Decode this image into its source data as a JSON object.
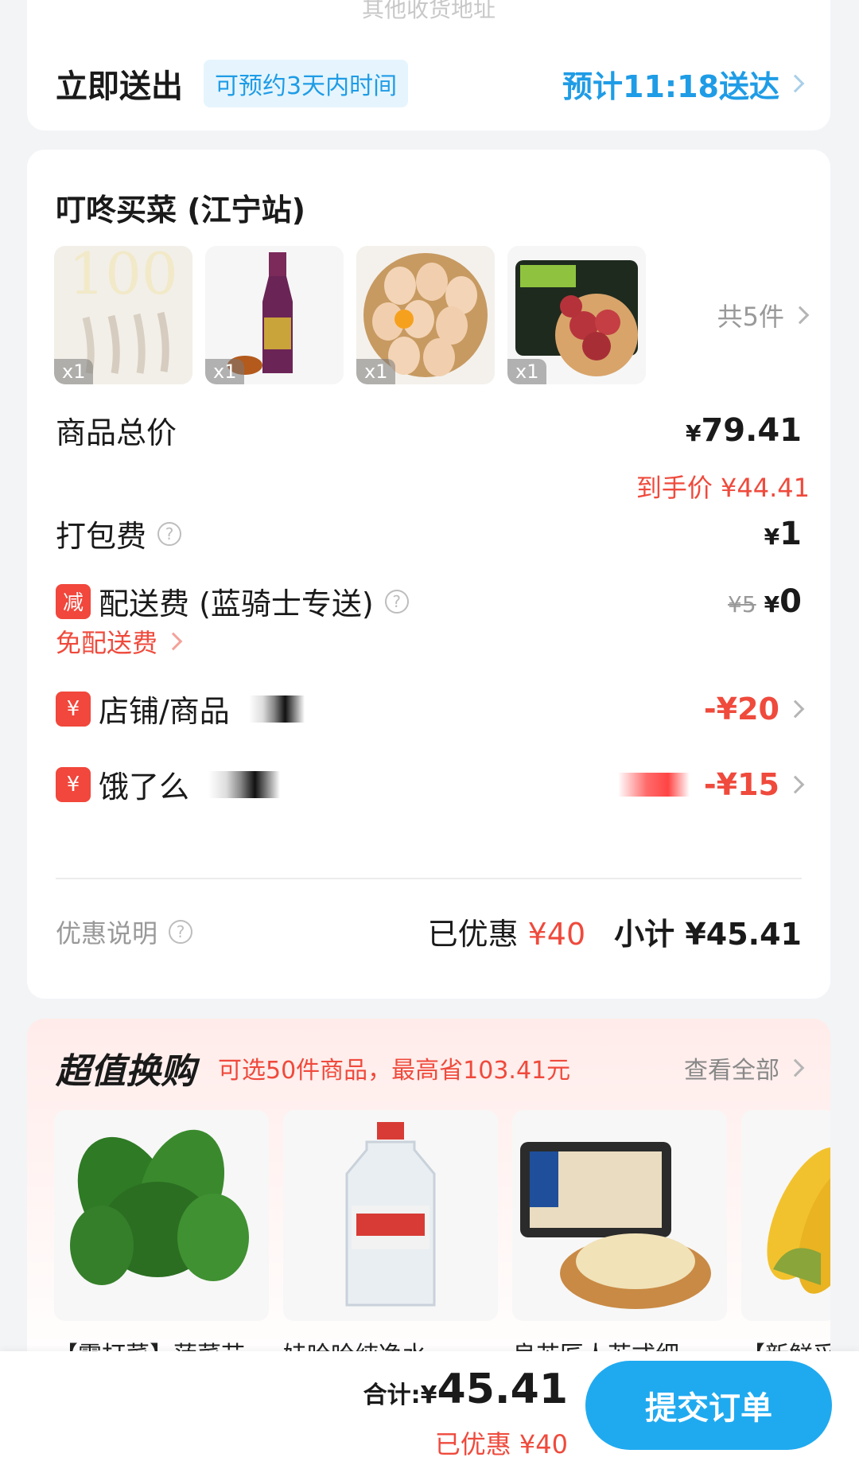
{
  "address": {
    "other_hint": "其他收货地址"
  },
  "schedule": {
    "title": "立即送出",
    "badge": "可预约3天内时间",
    "eta": "预计11:18送达"
  },
  "store": {
    "name": "叮咚买菜 (江宁站)",
    "items": [
      {
        "name": "虾",
        "qty": "x1"
      },
      {
        "name": "料酒",
        "qty": "x1"
      },
      {
        "name": "鸡蛋",
        "qty": "x1"
      },
      {
        "name": "新鲜肉",
        "qty": "x1"
      }
    ],
    "more_count": "共5件"
  },
  "fees": {
    "goods_label": "商品总价",
    "goods_value": "79.41",
    "final_price": "到手价 ¥44.41",
    "packing_label": "打包费",
    "packing_value": "1",
    "delivery_tag": "减",
    "delivery_label": "配送费 (蓝骑士专送)",
    "delivery_original": "¥5",
    "delivery_value": "0",
    "free_delivery": "免配送费"
  },
  "discounts": [
    {
      "tag": "¥",
      "label": "店铺/商品",
      "value": "-¥20"
    },
    {
      "tag": "¥",
      "label": "饿了么",
      "value": "-¥15"
    }
  ],
  "summary": {
    "promo_note": "优惠说明",
    "saved_label": "已优惠",
    "saved_amount": "¥40",
    "subtotal": "小计 ¥45.41"
  },
  "deals": {
    "title": "超值换购",
    "subtitle": "可选50件商品，最高省103.41元",
    "view_all": "查看全部",
    "products": [
      {
        "name": "【露打菜】菠菜苗"
      },
      {
        "name": "娃哈哈纯净水"
      },
      {
        "name": "良芯匠人苏式细"
      },
      {
        "name": "【新鲜采"
      }
    ]
  },
  "bottom_bar": {
    "total_label": "合计:",
    "total_amount": "45.41",
    "saved": "已优惠 ¥40",
    "submit": "提交订单"
  },
  "colors": {
    "accent_blue": "#1faaf0",
    "accent_red": "#ef4a3c"
  }
}
